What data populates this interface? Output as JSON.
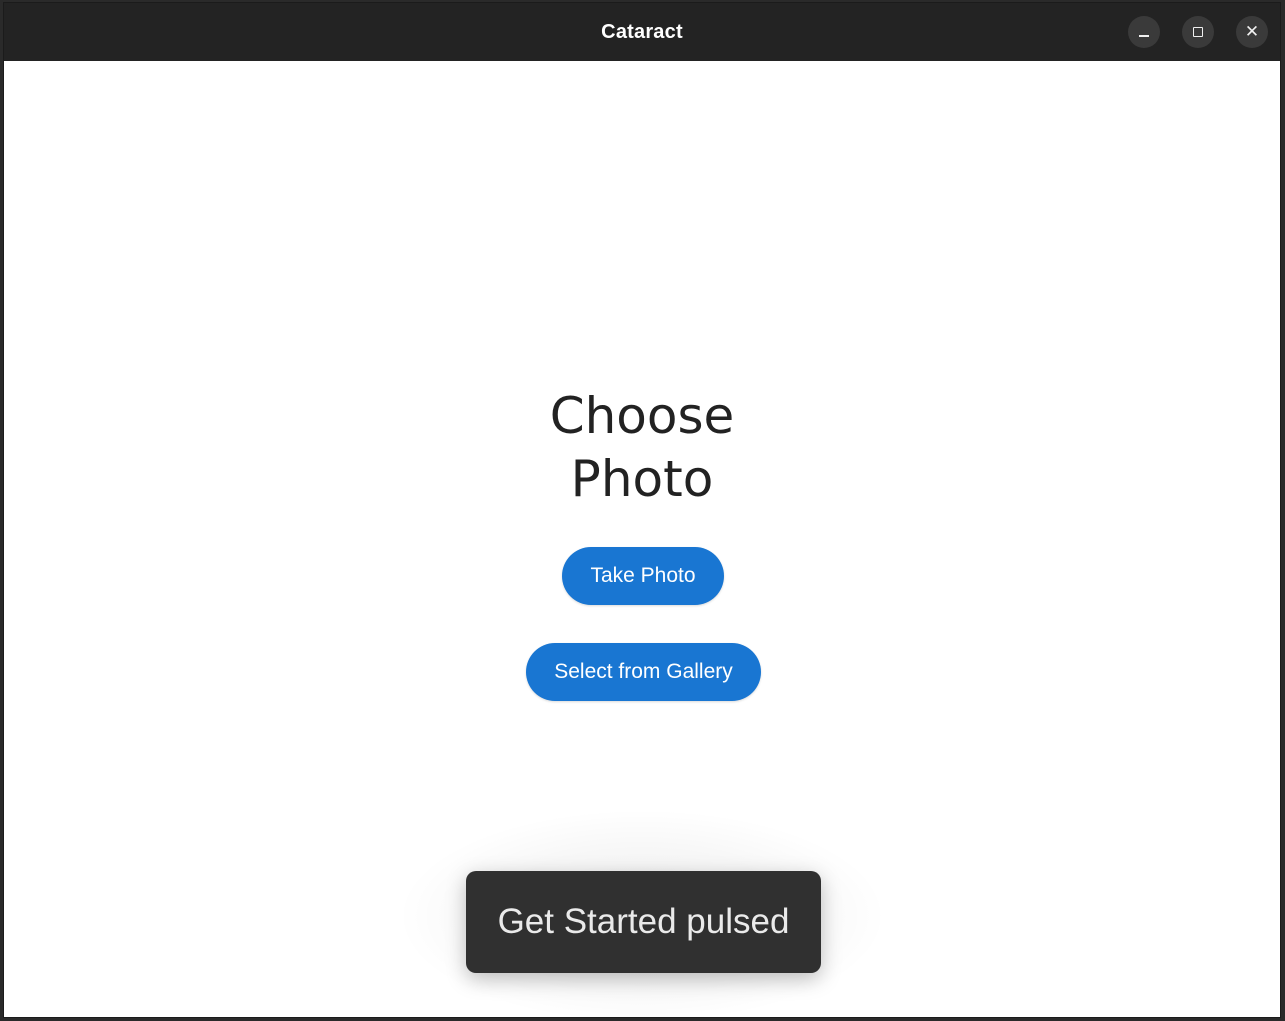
{
  "window": {
    "title": "Cataract",
    "controls": {
      "minimize_icon": "minimize-icon",
      "maximize_icon": "maximize-icon",
      "close_icon": "close-icon",
      "close_glyph": "✕"
    }
  },
  "main": {
    "heading_line1": "Choose",
    "heading_line2": "Photo",
    "take_photo_label": "Take Photo",
    "gallery_label": "Select from Gallery"
  },
  "toast": {
    "message": "Get Started pulsed"
  },
  "colors": {
    "titlebar": "#232323",
    "accent": "#1976d2",
    "toast_bg": "#303030",
    "background": "#ffffff"
  }
}
